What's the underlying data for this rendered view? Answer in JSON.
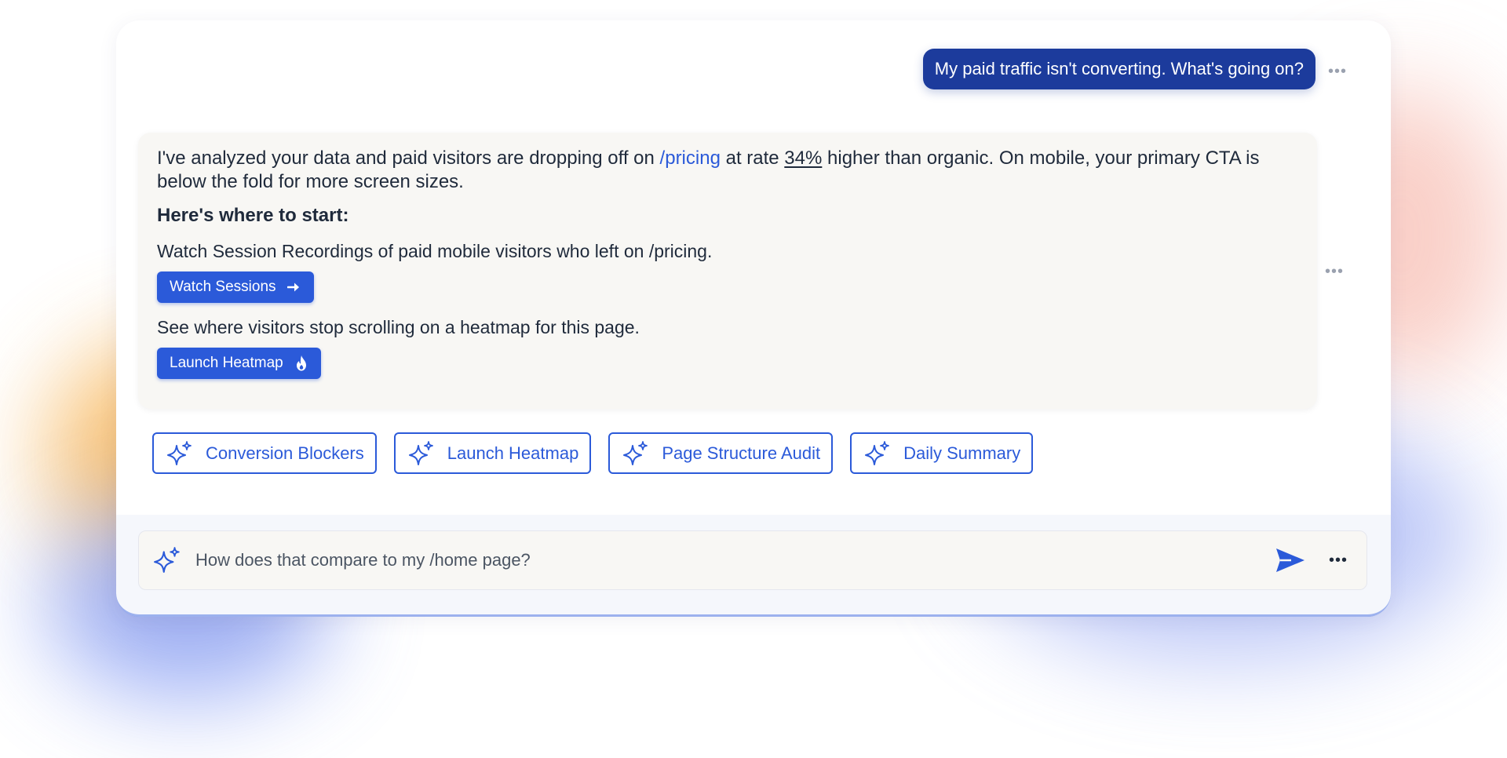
{
  "user_message": {
    "text": "My paid traffic isn't converting. What's going on?",
    "more_icon": "more-horizontal-icon"
  },
  "assistant": {
    "intro_before_link": "I've analyzed your data and paid visitors are dropping off on ",
    "intro_link": "/pricing",
    "intro_middle": " at rate ",
    "intro_stat": "34%",
    "intro_after": " higher than organic. On mobile, your primary CTA is below the fold for more screen sizes.",
    "subheading": "Here's where to start:",
    "steps": [
      {
        "text": "Watch Session Recordings of paid mobile visitors who left on /pricing.",
        "button_label": "Watch Sessions",
        "button_icon": "arrow-right-icon"
      },
      {
        "text": "See where visitors stop scrolling on a heatmap for this page.",
        "button_label": "Launch Heatmap",
        "button_icon": "flame-icon"
      }
    ],
    "more_icon": "more-horizontal-icon"
  },
  "suggestions": [
    {
      "label": "Conversion Blockers",
      "icon": "sparkles-icon"
    },
    {
      "label": "Launch Heatmap",
      "icon": "sparkles-icon"
    },
    {
      "label": "Page Structure Audit",
      "icon": "sparkles-icon"
    },
    {
      "label": "Daily Summary",
      "icon": "sparkles-icon"
    }
  ],
  "composer": {
    "value": "How does that compare to my /home page?",
    "leading_icon": "sparkles-icon",
    "send_icon": "send-icon",
    "more_icon": "more-horizontal-icon"
  },
  "colors": {
    "accent": "#2b5ad9",
    "user_bubble": "#1c3b9c",
    "card_bg": "#f8f7f4",
    "text": "#1f2a3b"
  }
}
